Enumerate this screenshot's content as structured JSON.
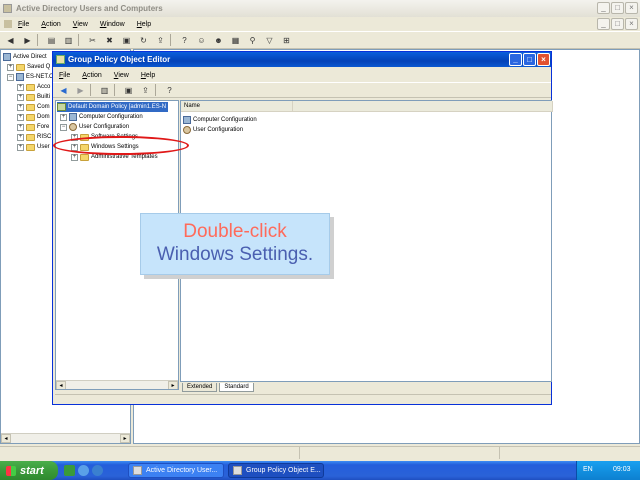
{
  "bg_window": {
    "title": "Active Directory Users and Computers",
    "menu": [
      {
        "label": "File",
        "u": "F",
        "rest": "ile"
      },
      {
        "label": "Action",
        "u": "A",
        "rest": "ction"
      },
      {
        "label": "View",
        "u": "V",
        "rest": "iew"
      },
      {
        "label": "Window",
        "u": "W",
        "rest": "indow"
      },
      {
        "label": "Help",
        "u": "H",
        "rest": "elp"
      }
    ],
    "tree": [
      "Active Direct",
      "Saved Q",
      "ES-NET.C",
      "Acco",
      "Builti",
      "Com",
      "Dom",
      "Fore",
      "RISC",
      "User"
    ]
  },
  "gpo_window": {
    "title": "Group Policy Object Editor",
    "menu": [
      {
        "u": "F",
        "rest": "ile"
      },
      {
        "u": "A",
        "rest": "ction"
      },
      {
        "u": "V",
        "rest": "iew"
      },
      {
        "u": "H",
        "rest": "elp"
      }
    ],
    "tree": {
      "root": "Default Domain Policy [admin1.ES-N",
      "computer_config": "Computer Configuration",
      "user_config": "User Configuration",
      "software_settings": "Software Settings",
      "windows_settings": "Windows Settings",
      "admin_templates": "Administrative Templates"
    },
    "right_pane": {
      "column_name": "Name",
      "items": [
        "Computer Configuration",
        "User Configuration"
      ]
    },
    "tabs": [
      "Extended",
      "Standard"
    ]
  },
  "callout": {
    "line1": "Double-click",
    "line2": "Windows Settings."
  },
  "taskbar": {
    "start": "start",
    "tasks": [
      "Active Directory User...",
      "Group Policy Object E..."
    ],
    "language": "EN",
    "clock": "09:03"
  },
  "colors": {
    "callout_bg": "#c6e4fb",
    "callout_line1": "#ff6a5a",
    "callout_line2": "#4a5fb0",
    "highlight_ellipse": "#e01818",
    "titlebar_active": "#0442b8"
  }
}
